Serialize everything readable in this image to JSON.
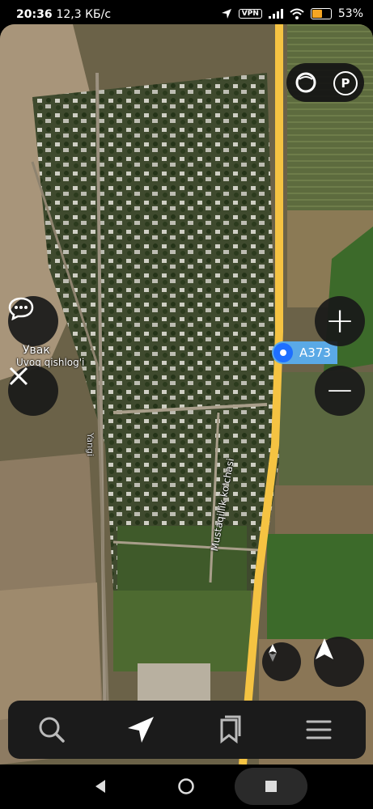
{
  "status_bar": {
    "time": "20:36",
    "speed": "12,3 КБ/с",
    "vpn": "VPN",
    "battery": "53"
  },
  "map": {
    "village_name_ru": "Увак",
    "village_name_uz": "Uvoq qishlog'i",
    "street_label_1": "Yangi",
    "street_label_2": "Mustaqillik ko'chasi",
    "road_badge": "A373",
    "layer_parking_label": "P"
  },
  "controls": {
    "zoom_in": "+",
    "zoom_out": "−"
  },
  "colors": {
    "accent": "#1e6fff",
    "road": "#f5c342",
    "panel": "#1b1b1b"
  },
  "icons": [
    "message-icon",
    "close-icon",
    "layers-icon",
    "parking-icon",
    "compass-icon",
    "navigate-icon",
    "search-icon",
    "route-icon",
    "bookmarks-icon",
    "menu-icon"
  ]
}
